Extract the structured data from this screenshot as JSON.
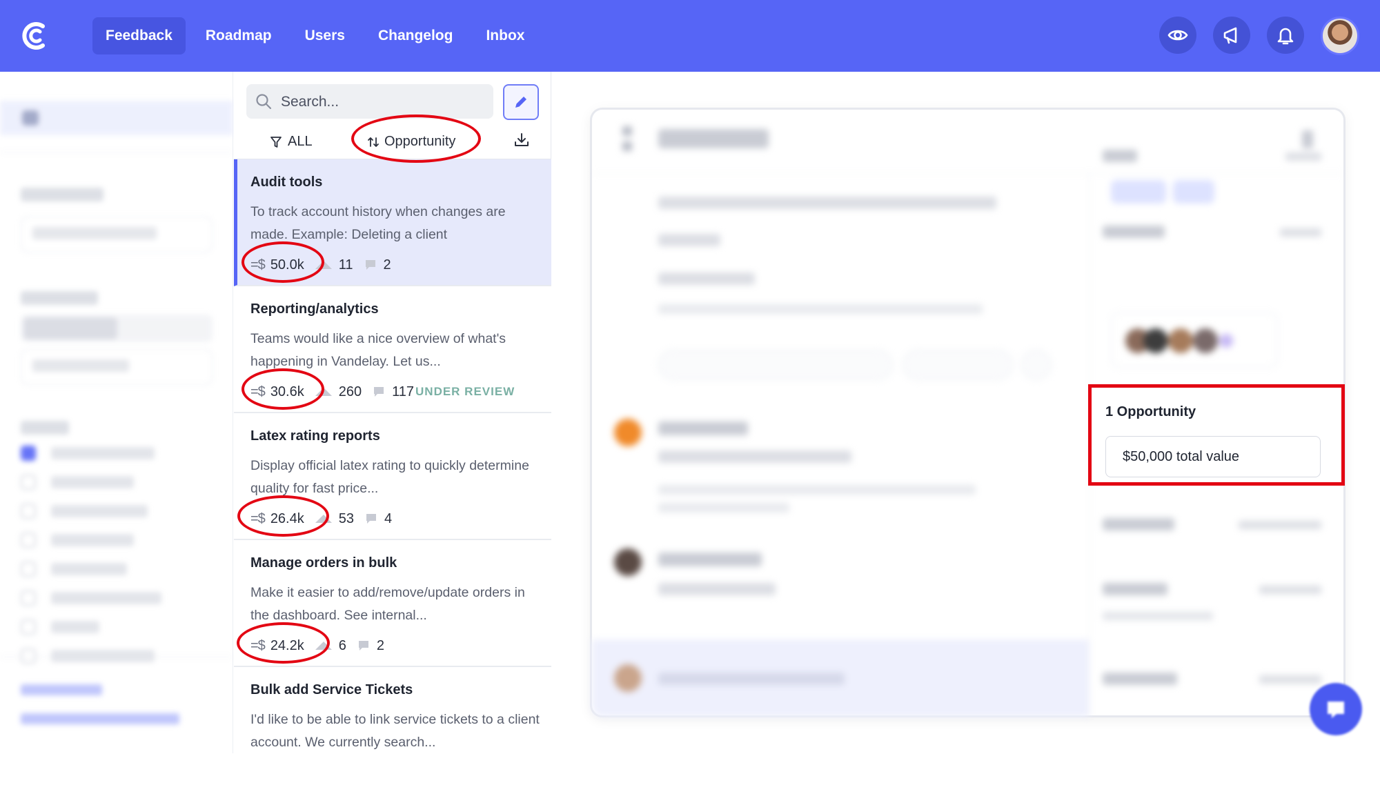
{
  "nav": {
    "items": [
      {
        "label": "Feedback",
        "active": true
      },
      {
        "label": "Roadmap"
      },
      {
        "label": "Users"
      },
      {
        "label": "Changelog"
      },
      {
        "label": "Inbox"
      }
    ]
  },
  "top_icons": [
    "eye-icon",
    "megaphone-icon",
    "bell-icon",
    "user-avatar"
  ],
  "colors": {
    "brand": "#5665f6",
    "highlight": "#e30613",
    "status_review": "#7ab0a4"
  },
  "list": {
    "search_placeholder": "Search...",
    "filter_label": "ALL",
    "sort_label": "Opportunity",
    "posts": [
      {
        "title": "Audit tools",
        "desc": "To track account history when changes are made. Example: Deleting a client",
        "opportunity": "50.0k",
        "votes": "11",
        "comments": "2",
        "status": ""
      },
      {
        "title": "Reporting/analytics",
        "desc": "Teams would like a nice overview of what's happening in Vandelay. Let us...",
        "opportunity": "30.6k",
        "votes": "260",
        "comments": "117",
        "status": "UNDER REVIEW"
      },
      {
        "title": "Latex rating reports",
        "desc": "Display official latex rating to quickly determine quality for fast price...",
        "opportunity": "26.4k",
        "votes": "53",
        "comments": "4",
        "status": ""
      },
      {
        "title": "Manage orders in bulk",
        "desc": "Make it easier to add/remove/update orders in the dashboard. See internal...",
        "opportunity": "24.2k",
        "votes": "6",
        "comments": "2",
        "status": ""
      },
      {
        "title": "Bulk add Service Tickets",
        "desc": "I'd like to be able to link service tickets to a client account. We currently search...",
        "opportunity": "",
        "votes": "",
        "comments": "",
        "status": ""
      }
    ]
  },
  "opportunity_panel": {
    "title": "1 Opportunity",
    "value": "$50,000 total value"
  }
}
